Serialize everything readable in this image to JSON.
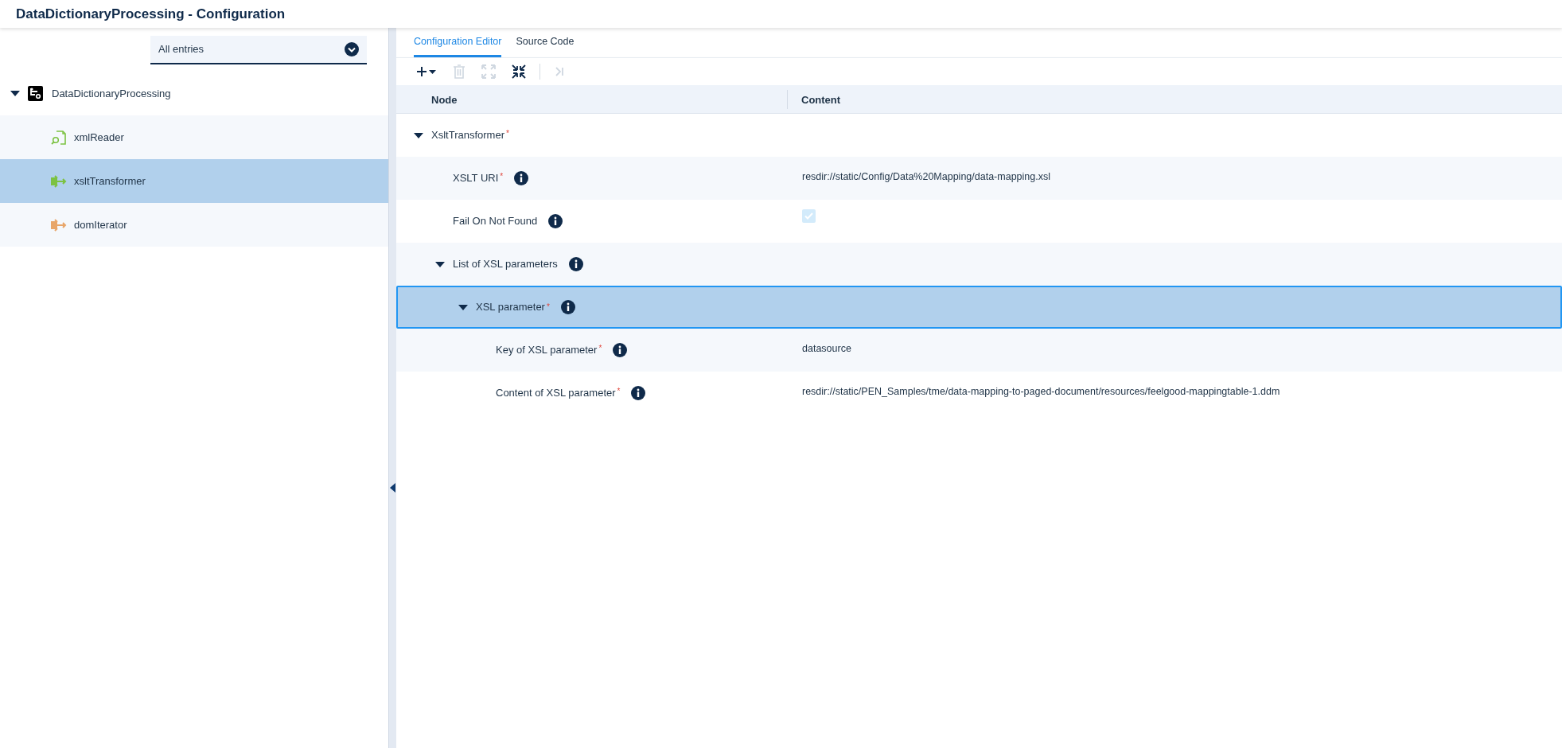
{
  "window": {
    "title": "DataDictionaryProcessing - Configuration"
  },
  "filter": {
    "value": "All entries"
  },
  "tree": {
    "label": "DataDictionaryProcessing",
    "expanded": true,
    "children": [
      {
        "label": "xmlReader",
        "kind": "reader",
        "selected": false
      },
      {
        "label": "xsltTransformer",
        "kind": "transformer",
        "selected": true
      },
      {
        "label": "domIterator",
        "kind": "iterator",
        "selected": false
      }
    ]
  },
  "tabs": [
    {
      "label": "Configuration Editor",
      "selected": true
    },
    {
      "label": "Source Code",
      "selected": false
    }
  ],
  "toolbar": [
    {
      "kind": "add",
      "disabled": false
    },
    {
      "kind": "delete",
      "disabled": true
    },
    {
      "kind": "expand",
      "disabled": true
    },
    {
      "kind": "collapse",
      "disabled": false
    },
    {
      "kind": "separator",
      "disabled": false
    },
    {
      "kind": "last",
      "disabled": true
    }
  ],
  "table": {
    "columns": [
      "Node",
      "Content"
    ],
    "nodes": [
      {
        "label": "XsltTransformer",
        "required_mark": "*",
        "info": false,
        "expanded": true,
        "selected": false,
        "children": [
          {
            "label": "XSLT URI",
            "required_mark": "*",
            "info": true,
            "selected": false,
            "value": "resdir://static/Config/Data%20Mapping/data-mapping.xsl"
          },
          {
            "label": "Fail On Not Found",
            "info": true,
            "selected": false,
            "checkbox": {
              "checked": true,
              "disabled": true
            }
          },
          {
            "label": "List of XSL parameters",
            "info": true,
            "expanded": true,
            "selected": false,
            "children": [
              {
                "label": "XSL parameter",
                "required_mark": "*",
                "info": true,
                "expanded": true,
                "selected": true,
                "children": [
                  {
                    "label": "Key of XSL parameter",
                    "required_mark": "*",
                    "info": true,
                    "selected": false,
                    "value": "datasource"
                  },
                  {
                    "label": "Content of XSL parameter",
                    "required_mark": "*",
                    "info": true,
                    "selected": false,
                    "value": "resdir://static/PEN_Samples/tme/data-mapping-to-paged-document/resources/feelgood-mappingtable-1.ddm"
                  }
                ]
              }
            ]
          }
        ]
      }
    ]
  }
}
